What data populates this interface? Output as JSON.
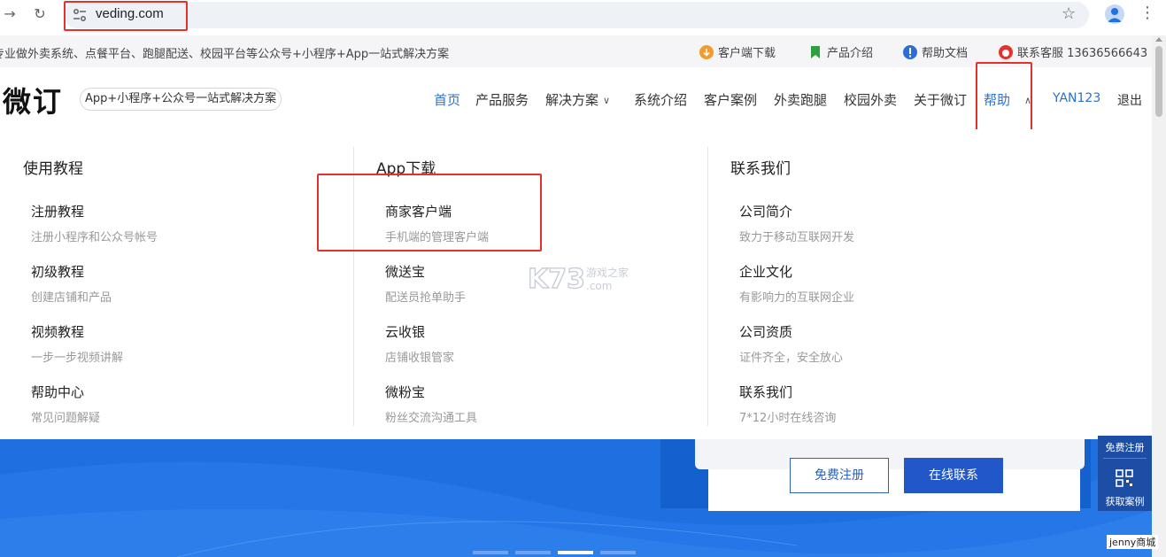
{
  "browser": {
    "url": "veding.com"
  },
  "topline": {
    "slogan": "专业做外卖系统、点餐平台、跑腿配送、校园平台等公众号+小程序+App一站式解决方案",
    "items": [
      {
        "label": "客户端下载",
        "icon": "download-icon",
        "color": "#f39b2b"
      },
      {
        "label": "产品介绍",
        "icon": "bookmark-icon",
        "color": "#2ea043"
      },
      {
        "label": "帮助文档",
        "icon": "info-icon",
        "color": "#2b6fd6"
      },
      {
        "label": "联系客服 13636566643",
        "icon": "service-icon",
        "color": "#e5312b"
      }
    ]
  },
  "header": {
    "logo": "微订",
    "tagline": "App+小程序+公众号一站式解决方案",
    "nav": [
      {
        "label": "首页",
        "active": true
      },
      {
        "label": "产品服务"
      },
      {
        "label": "解决方案",
        "chevron": "chevron-down-icon"
      },
      {
        "label": "系统介绍"
      },
      {
        "label": "客户案例"
      },
      {
        "label": "外卖跑腿"
      },
      {
        "label": "校园外卖"
      },
      {
        "label": "关于微订"
      },
      {
        "label": "帮助",
        "active": true,
        "chevron": "chevron-up-icon"
      }
    ],
    "user": "YAN123",
    "logout": "退出"
  },
  "mega": {
    "columns": [
      {
        "title": "使用教程",
        "items": [
          {
            "title": "注册教程",
            "sub": "注册小程序和公众号帐号"
          },
          {
            "title": "初级教程",
            "sub": "创建店铺和产品"
          },
          {
            "title": "视频教程",
            "sub": "一步一步视频讲解"
          },
          {
            "title": "帮助中心",
            "sub": "常见问题解疑"
          }
        ]
      },
      {
        "title": "App下载",
        "items": [
          {
            "title": "商家客户端",
            "sub": "手机端的管理客户端"
          },
          {
            "title": "微送宝",
            "sub": "配送员抢单助手"
          },
          {
            "title": "云收银",
            "sub": "店铺收银管家"
          },
          {
            "title": "微粉宝",
            "sub": "粉丝交流沟通工具"
          }
        ]
      },
      {
        "title": "联系我们",
        "items": [
          {
            "title": "公司简介",
            "sub": "致力于移动互联网开发"
          },
          {
            "title": "企业文化",
            "sub": "有影响力的互联网企业"
          },
          {
            "title": "公司资质",
            "sub": "证件齐全，安全放心"
          },
          {
            "title": "联系我们",
            "sub": "7*12小时在线咨询"
          }
        ]
      }
    ]
  },
  "hero": {
    "register_label": "免费注册",
    "contact_label": "在线联系"
  },
  "sidefloat": {
    "register": "免费注册",
    "cases": "获取案例"
  },
  "watermark": {
    "brand": "K73",
    "text": "游戏之家",
    "domain": ".com"
  },
  "credit": "jenny商城",
  "colors": {
    "accent": "#2b6fd6",
    "highlight_box": "#e5312b",
    "hero_blue": "#1e6fe0"
  }
}
